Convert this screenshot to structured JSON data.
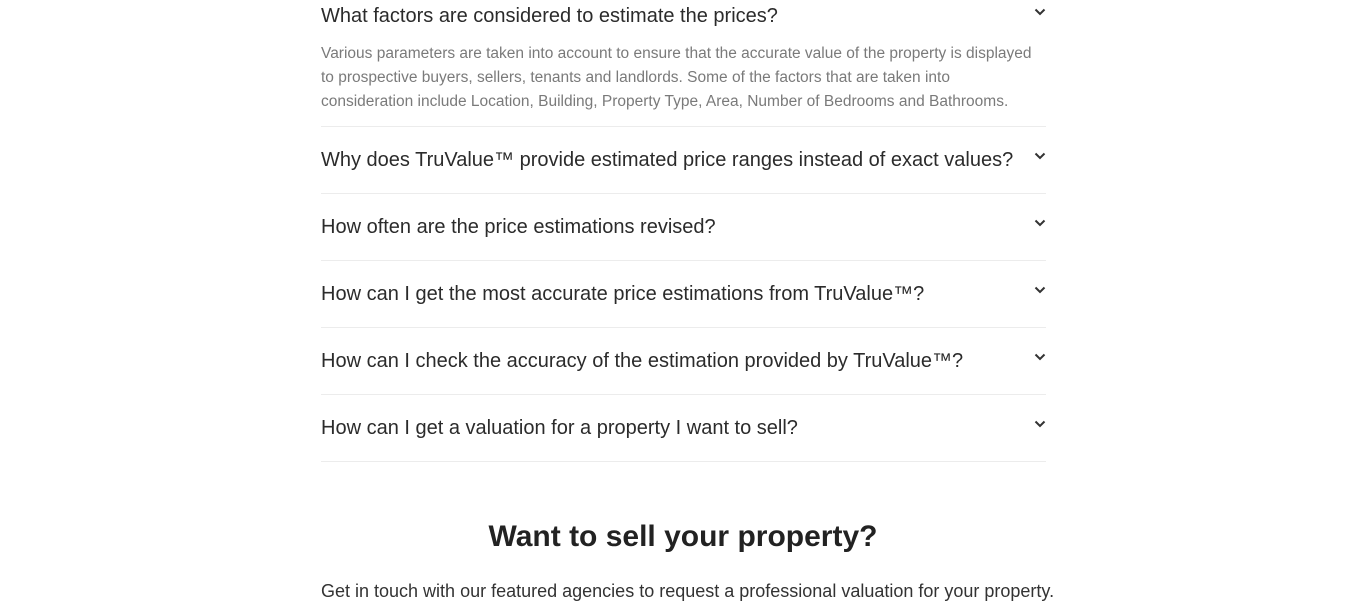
{
  "faq": {
    "items": [
      {
        "question": "What factors are considered to estimate the prices?",
        "answer": "Various parameters are taken into account to ensure that the accurate value of the property is displayed to prospective buyers, sellers, tenants and landlords. Some of the factors that are taken into consideration include Location, Building, Property Type, Area, Number of Bedrooms and Bathrooms.",
        "expanded": true
      },
      {
        "question": "Why does TruValue™ provide estimated price ranges instead of exact values?",
        "expanded": false
      },
      {
        "question": "How often are the price estimations revised?",
        "expanded": false
      },
      {
        "question": "How can I get the most accurate price estimations from TruValue™?",
        "expanded": false
      },
      {
        "question": "How can I check the accuracy of the estimation provided by TruValue™?",
        "expanded": false
      },
      {
        "question": "How can I get a valuation for a property I want to sell?",
        "expanded": false
      }
    ]
  },
  "sell": {
    "title": "Want to sell your property?",
    "text": "Get in touch with our featured agencies to request a professional valuation for your property."
  },
  "icons": {
    "chevron": "chevron-down-icon"
  },
  "colors": {
    "question": "#2b2b2b",
    "answer": "#7a7a7a",
    "divider": "#ececec"
  }
}
